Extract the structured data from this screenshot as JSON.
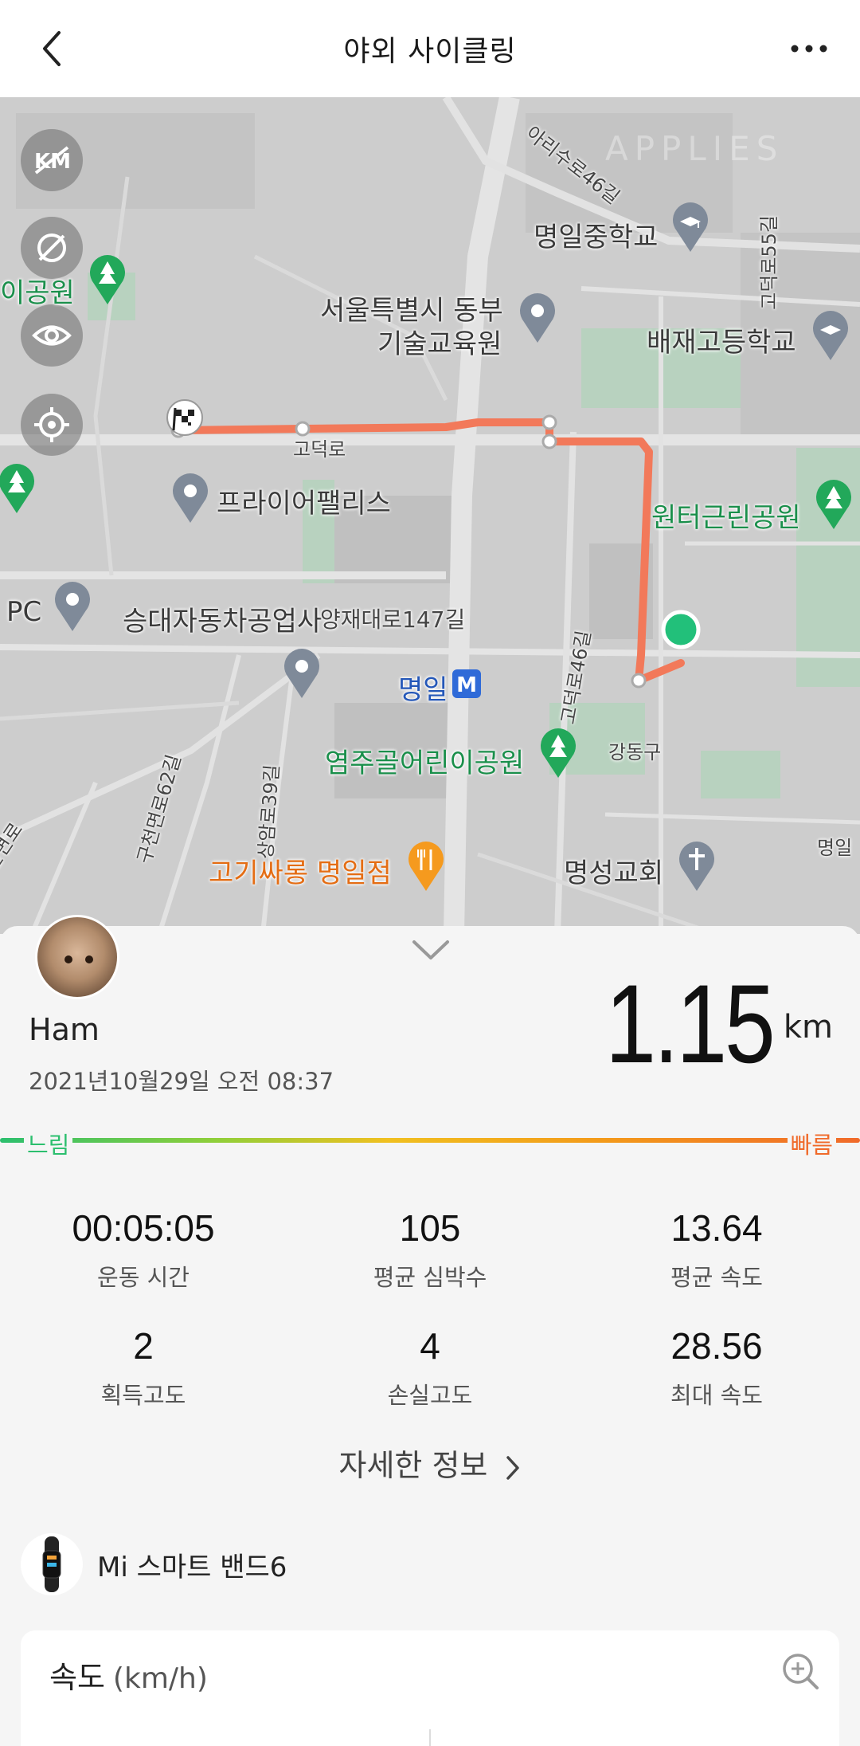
{
  "header": {
    "title": "야외 사이클링"
  },
  "map": {
    "labels": {
      "school1": "명일중학교",
      "edu_line1": "서울특별시 동부",
      "edu_line2": "기술교육원",
      "school2": "배재고등학교",
      "park_left": "이공원",
      "palace": "프라이어팰리스",
      "park_right": "원터근린공원",
      "pc": "PC",
      "car_shop": "승대자동차공업사",
      "road_ydr": "양재대로147길",
      "station": "명일",
      "station_badge": "M",
      "kids_park": "염주골어린이공원",
      "gangdong": "강동구",
      "restaurant": "고기싸롱 명일점",
      "church": "명성교회",
      "gdr": "고덕로",
      "arisu": "아리수로46길",
      "gdr55": "고덕로55길",
      "gdr46": "고덕로46길",
      "gch62": "구천면로62길",
      "sir39": "상암로39길",
      "gchr": "구천면로",
      "myeongil_edge": "명일",
      "watermark": "APPLIES"
    },
    "controls": [
      "km-toggle-icon",
      "satellite-off-icon",
      "eye-icon",
      "locate-icon"
    ]
  },
  "summary": {
    "username": "Ham",
    "datetime": "2021년10월29일 오전 08:37",
    "distance": "1.15",
    "distance_unit": "km",
    "speed_slow": "느림",
    "speed_fast": "빠름"
  },
  "stats": [
    {
      "value": "00:05:05",
      "label": "운동 시간"
    },
    {
      "value": "105",
      "label": "평균 심박수"
    },
    {
      "value": "13.64",
      "label": "평균 속도"
    },
    {
      "value": "2",
      "label": "획득고도"
    },
    {
      "value": "4",
      "label": "손실고도"
    },
    {
      "value": "28.56",
      "label": "최대 속도"
    }
  ],
  "detail_link": "자세한 정보",
  "device": {
    "name": "Mi 스마트 밴드6"
  },
  "speed_card": {
    "title": "속도",
    "unit": "(km/h)"
  },
  "colors": {
    "route": "#f2795a",
    "park_green": "#1a8f4b",
    "slow": "#2cbf6e",
    "fast": "#f06a2a"
  }
}
